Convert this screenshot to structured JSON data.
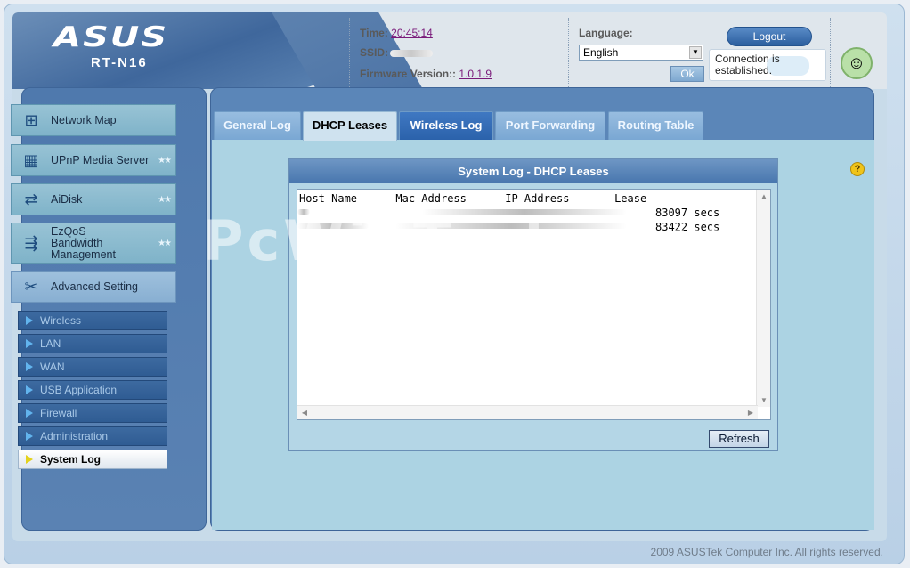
{
  "header": {
    "brand": "/ISUS",
    "model": "RT-N16",
    "time_label": "Time:",
    "time_value": "20:45:14",
    "ssid_label": "SSID:",
    "firmware_label": "Firmware Version::",
    "firmware_value": "1.0.1.9",
    "language_label": "Language:",
    "language_value": "English",
    "ok_label": "Ok",
    "logout_label": "Logout",
    "status_text": "Connection is established."
  },
  "sidebar": {
    "menu": [
      {
        "label": "Network Map",
        "icon": "network-map-icon"
      },
      {
        "label": "UPnP Media Server",
        "icon": "media-server-icon"
      },
      {
        "label": "AiDisk",
        "icon": "aidisk-icon"
      },
      {
        "label": "EzQoS Bandwidth Management",
        "icon": "qos-icon"
      },
      {
        "label": "Advanced Setting",
        "icon": "wrench-icon"
      }
    ],
    "subitems": [
      "Wireless",
      "LAN",
      "WAN",
      "USB Application",
      "Firewall",
      "Administration",
      "System Log"
    ],
    "active_subitem": "System Log"
  },
  "tabs": [
    "General Log",
    "DHCP Leases",
    "Wireless Log",
    "Port Forwarding",
    "Routing Table"
  ],
  "active_tab": "DHCP Leases",
  "log": {
    "title": "System Log - DHCP Leases",
    "columns": [
      "Host Name",
      "Mac Address",
      "IP Address",
      "Lease"
    ],
    "rows": [
      {
        "lease": "83097 secs"
      },
      {
        "lease": "83422 secs"
      }
    ],
    "refresh_label": "Refresh"
  },
  "watermark": "PcWinTech.com",
  "footer": "2009 ASUSTek Computer Inc. All rights reserved.",
  "colors": {
    "accent": "#4876ae",
    "content_bg": "#acd3e3"
  }
}
